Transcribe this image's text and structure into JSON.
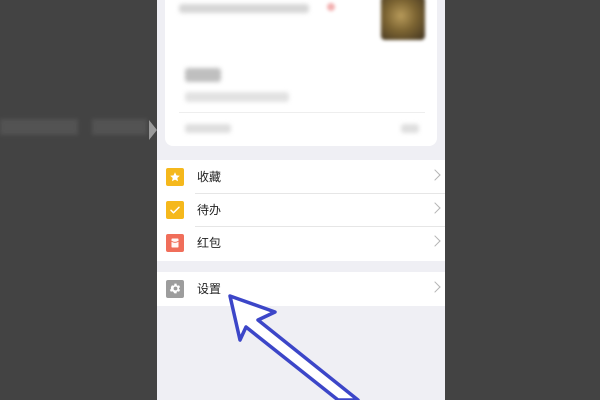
{
  "menu": {
    "group1": [
      {
        "label": "收藏",
        "icon": "star-icon",
        "icon_color": "#f5b81c"
      },
      {
        "label": "待办",
        "icon": "checkmark-icon",
        "icon_color": "#f5b81c"
      },
      {
        "label": "红包",
        "icon": "red-envelope-icon",
        "icon_color": "#f06e5a"
      }
    ],
    "group2": [
      {
        "label": "设置",
        "icon": "gear-icon",
        "icon_color": "#9d9d9d"
      }
    ]
  },
  "annotation": {
    "arrow_color": "#3c46c8",
    "target": "设置"
  },
  "colors": {
    "backdrop": "#434343",
    "screen_bg": "#efeff4",
    "card_bg": "#ffffff"
  }
}
